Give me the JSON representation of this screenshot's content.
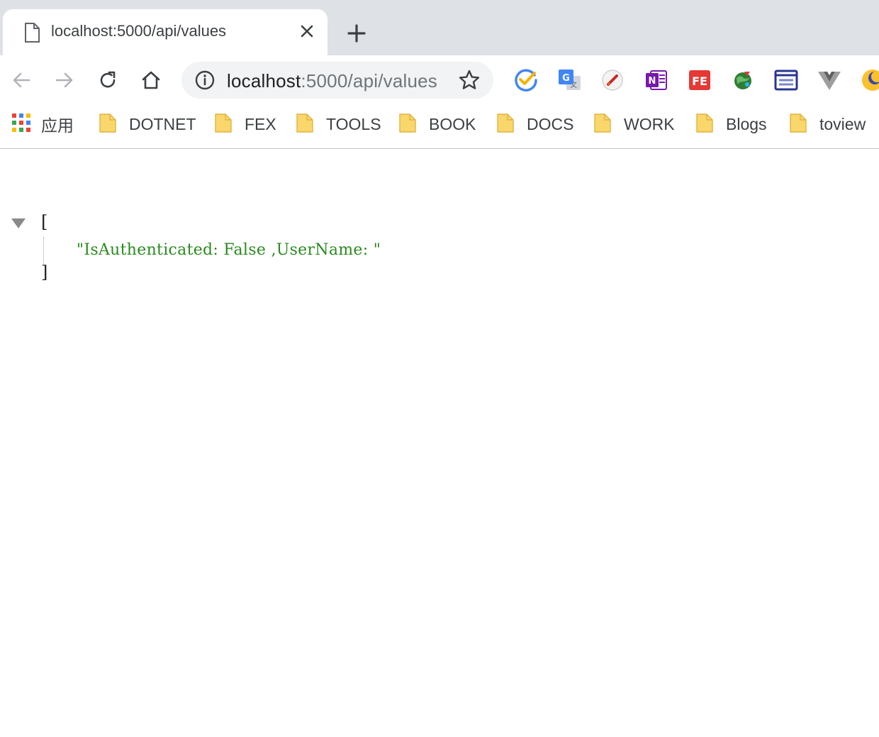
{
  "tab": {
    "title": "localhost:5000/api/values",
    "favicon": "document-icon"
  },
  "toolbar": {
    "url_host": "localhost",
    "url_path": ":5000/api/values",
    "extensions": [
      "checkmark-extension-icon",
      "google-translate-icon",
      "rocket-extension-icon",
      "onenote-icon",
      "fe-extension-icon",
      "globe-extension-icon",
      "window-extension-icon",
      "vue-devtools-icon",
      "moon-extension-icon"
    ]
  },
  "bookmarks": {
    "apps_label": "应用",
    "items": [
      {
        "label": "DOTNET"
      },
      {
        "label": "FEX"
      },
      {
        "label": "TOOLS"
      },
      {
        "label": "BOOK"
      },
      {
        "label": "DOCS"
      },
      {
        "label": "WORK"
      },
      {
        "label": "Blogs"
      },
      {
        "label": "toview"
      }
    ]
  },
  "page": {
    "open_bracket": "[",
    "close_bracket": "]",
    "value": "\"IsAuthenticated: False ,UserName: \""
  },
  "colors": {
    "tabstrip": "#dee1e6",
    "omnibox": "#f1f3f4",
    "json_string": "#2a8a1f",
    "folder": "#fad76b"
  }
}
